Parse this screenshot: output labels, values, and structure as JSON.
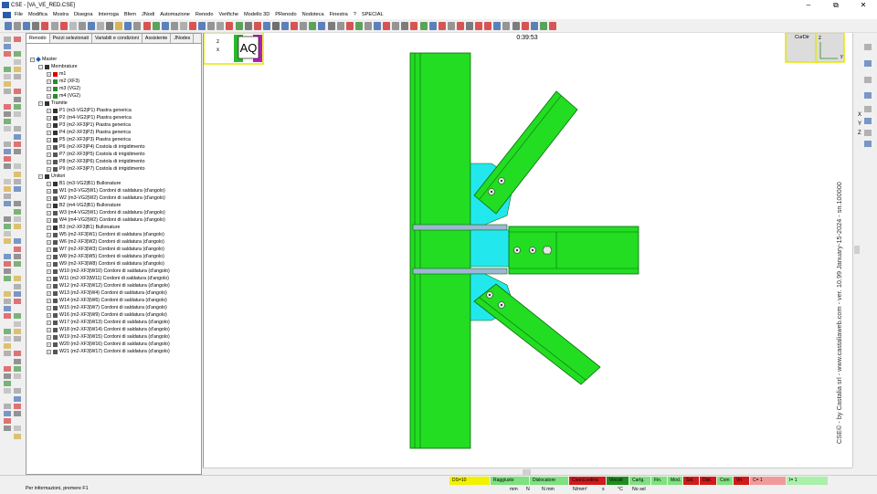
{
  "window": {
    "title": "CSE - [VA_VE_RED.CSE]",
    "min": "–",
    "restore": "⧉",
    "close": "✕"
  },
  "menu": [
    "File",
    "Modifica",
    "Mostra",
    "Disegna",
    "Interroga",
    "Bfem",
    "JNodi",
    "Automazione",
    "Renodo",
    "Verifiche",
    "Modello 3D",
    "PRenodo",
    "Nodoteca",
    "Finestra",
    "?",
    "SPECIAL"
  ],
  "tabs": [
    "Renodo",
    "Pezzi selezionati",
    "Variabili e condizioni",
    "Assistente",
    "JNodes"
  ],
  "tree": [
    {
      "level": 0,
      "text": "Master",
      "icon": "diamond-icon",
      "color": "#1f5bb5"
    },
    {
      "level": 1,
      "text": "Membrature",
      "icon": "members-icon",
      "color": "#333"
    },
    {
      "level": 2,
      "text": "m1",
      "icon": "M-icon",
      "color": "#d00"
    },
    {
      "level": 2,
      "text": "m2 (XF3)",
      "icon": "S-icon",
      "color": "#2a8a2a"
    },
    {
      "level": 2,
      "text": "m3 (VG2)",
      "icon": "S-icon",
      "color": "#2a8a2a"
    },
    {
      "level": 2,
      "text": "m4 (VG2)",
      "icon": "S-icon",
      "color": "#2a8a2a"
    },
    {
      "level": 1,
      "text": "Tramite",
      "icon": "group-icon",
      "color": "#333"
    },
    {
      "level": 2,
      "text": "P1 (m3-VG2|P1)  Piastra generica",
      "icon": "plate-icon",
      "color": "#333"
    },
    {
      "level": 2,
      "text": "P2 (m4-VG2|P1)  Piastra generica",
      "icon": "plate-icon",
      "color": "#333"
    },
    {
      "level": 2,
      "text": "P3 (m2-XF3|P1)  Piastra generica",
      "icon": "plate-icon",
      "color": "#333"
    },
    {
      "level": 2,
      "text": "P4 (m2-XF3|P2)  Piastra generica",
      "icon": "plate-icon",
      "color": "#333"
    },
    {
      "level": 2,
      "text": "P5 (m2-XF3|P3)  Piastra generica",
      "icon": "plate-icon",
      "color": "#333"
    },
    {
      "level": 2,
      "text": "P6 (m2-XF3|P4)  Costola di irrigidimento",
      "icon": "rib-icon",
      "color": "#555"
    },
    {
      "level": 2,
      "text": "P7 (m2-XF3|P5)  Costola di irrigidimento",
      "icon": "rib-icon",
      "color": "#555"
    },
    {
      "level": 2,
      "text": "P8 (m2-XF3|P6)  Costola di irrigidimento",
      "icon": "rib-icon",
      "color": "#555"
    },
    {
      "level": 2,
      "text": "P9 (m2-XF3|P7)  Costola di irrigidimento",
      "icon": "rib-icon",
      "color": "#555"
    },
    {
      "level": 1,
      "text": "Unitori",
      "icon": "group-icon",
      "color": "#333"
    },
    {
      "level": 2,
      "text": "B1 (m3-VG2|B1)  Bullonature",
      "icon": "bolt-icon",
      "color": "#333"
    },
    {
      "level": 2,
      "text": "W1 (m3-VG2|W1)  Cordoni di saldatura (d'angolo)",
      "icon": "weld-icon",
      "color": "#555"
    },
    {
      "level": 2,
      "text": "W2 (m3-VG2|W2)  Cordoni di saldatura (d'angolo)",
      "icon": "weld-icon",
      "color": "#555"
    },
    {
      "level": 2,
      "text": "B2 (m4-VG2|B1)  Bullonature",
      "icon": "bolt-icon",
      "color": "#333"
    },
    {
      "level": 2,
      "text": "W3 (m4-VG2|W1)  Cordoni di saldatura (d'angolo)",
      "icon": "weld-icon",
      "color": "#555"
    },
    {
      "level": 2,
      "text": "W4 (m4-VG2|W2)  Cordoni di saldatura (d'angolo)",
      "icon": "weld-icon",
      "color": "#555"
    },
    {
      "level": 2,
      "text": "B3 (m2-XF3|B1)  Bullonature",
      "icon": "bolt-icon",
      "color": "#333"
    },
    {
      "level": 2,
      "text": "W5 (m2-XF3|W1)  Cordoni di saldatura (d'angolo)",
      "icon": "weld-icon",
      "color": "#555"
    },
    {
      "level": 2,
      "text": "W6 (m2-XF3|W2)  Cordoni di saldatura (d'angolo)",
      "icon": "weld-icon",
      "color": "#555"
    },
    {
      "level": 2,
      "text": "W7 (m2-XF3|W3)  Cordoni di saldatura (d'angolo)",
      "icon": "weld-icon",
      "color": "#555"
    },
    {
      "level": 2,
      "text": "W8 (m2-XF3|W5)  Cordoni di saldatura (d'angolo)",
      "icon": "weld-icon",
      "color": "#555"
    },
    {
      "level": 2,
      "text": "W9 (m2-XF3|W8)  Cordoni di saldatura (d'angolo)",
      "icon": "weld-icon",
      "color": "#555"
    },
    {
      "level": 2,
      "text": "W10 (m2-XF3|W10)  Cordoni di saldatura (d'angolo)",
      "icon": "weld-icon",
      "color": "#555"
    },
    {
      "level": 2,
      "text": "W11 (m2-XF3|W11)  Cordoni di saldatura (d'angolo)",
      "icon": "weld-icon",
      "color": "#555"
    },
    {
      "level": 2,
      "text": "W12 (m2-XF3|W12)  Cordoni di saldatura (d'angolo)",
      "icon": "weld-icon",
      "color": "#555"
    },
    {
      "level": 2,
      "text": "W13 (m2-XF3|W4)  Cordoni di saldatura (d'angolo)",
      "icon": "weld-icon",
      "color": "#555"
    },
    {
      "level": 2,
      "text": "W14 (m2-XF3|W6)  Cordoni di saldatura (d'angolo)",
      "icon": "weld-icon",
      "color": "#555"
    },
    {
      "level": 2,
      "text": "W15 (m2-XF3|W7)  Cordoni di saldatura (d'angolo)",
      "icon": "weld-icon",
      "color": "#555"
    },
    {
      "level": 2,
      "text": "W16 (m2-XF3|W9)  Cordoni di saldatura (d'angolo)",
      "icon": "weld-icon",
      "color": "#555"
    },
    {
      "level": 2,
      "text": "W17 (m2-XF3|W13)  Cordoni di saldatura (d'angolo)",
      "icon": "weld-icon",
      "color": "#555"
    },
    {
      "level": 2,
      "text": "W18 (m2-XF3|W14)  Cordoni di saldatura (d'angolo)",
      "icon": "weld-icon",
      "color": "#555"
    },
    {
      "level": 2,
      "text": "W19 (m2-XF3|W15)  Cordoni di saldatura (d'angolo)",
      "icon": "weld-icon",
      "color": "#555"
    },
    {
      "level": 2,
      "text": "W20 (m2-XF3|W16)  Cordoni di saldatura (d'angolo)",
      "icon": "weld-icon",
      "color": "#555"
    },
    {
      "level": 2,
      "text": "W21 (m2-XF3|W17)  Cordoni di saldatura (d'angolo)",
      "icon": "weld-icon",
      "color": "#555"
    }
  ],
  "viewport": {
    "timer": "0:39:53",
    "view_badge": "AQ",
    "axis_z": "z",
    "axis_x": "x",
    "axis_y": "y",
    "curdir_label": "CurDir",
    "watermark": "CSE© - by Castalia srl - www.castaliaweb.com - ver. 10.99 January-15-2024 - sn.100000",
    "colors": {
      "steel": "#22dd22",
      "steel_edge": "#0a6b0a",
      "plate": "#22e8ee",
      "badge_bg": "#e8e8a0",
      "badge_border": "#c8c800"
    }
  },
  "right_tools": [
    "X",
    "Y",
    "Z"
  ],
  "status": {
    "message": "Per informazioni, premere F1",
    "chips": [
      {
        "text": "DS=10",
        "bg": "#f2f200"
      },
      {
        "text": "Raggiusto",
        "bg": "#7ee27e"
      },
      {
        "text": "Dislocatore",
        "bg": "#7ee27e"
      },
      {
        "text": "Coord.ordina",
        "bg": "#d21a1a"
      },
      {
        "text": "Vincoli",
        "bg": "#1e8e1e"
      },
      {
        "text": "Cartg.",
        "bg": "#7ee27e"
      },
      {
        "text": "Fin.",
        "bg": "#7ee27e"
      },
      {
        "text": "Mod.",
        "bg": "#7ee27e"
      },
      {
        "text": "Sol.",
        "bg": "#d21a1a"
      },
      {
        "text": "Dist.",
        "bg": "#d21a1a"
      },
      {
        "text": "Com",
        "bg": "#7ee27e"
      },
      {
        "text": "Vn",
        "bg": "#d21a1a"
      },
      {
        "text": "C= 1",
        "bg": "#f29a9a"
      },
      {
        "text": "I= 1",
        "bg": "#a9f0a9"
      }
    ],
    "units": [
      "mm",
      "N",
      "N mm",
      "N/mm²",
      "s",
      "°C",
      "No sel"
    ]
  }
}
